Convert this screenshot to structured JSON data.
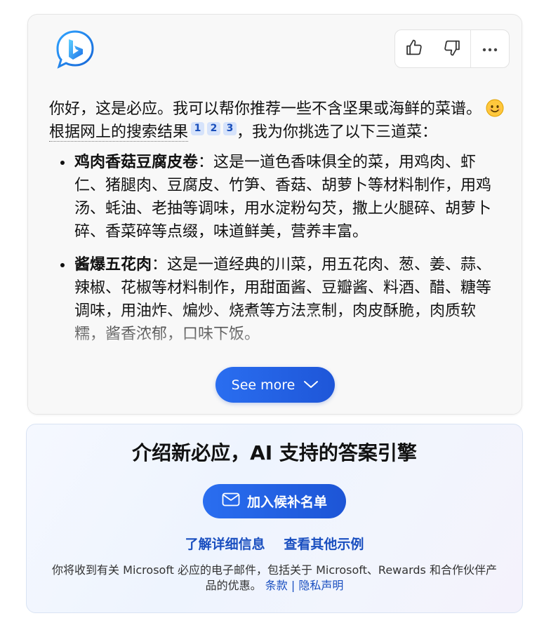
{
  "answer": {
    "greeting": "你好，这是必应。我可以帮你推荐一些不含坚果或海鲜的菜谱。",
    "sources_phrase": "根据网上的搜索结果",
    "citations": [
      "1",
      "2",
      "3"
    ],
    "sources_suffix": "，我为你挑选了以下三道菜：",
    "recipes": [
      {
        "name": "鸡肉香菇豆腐皮卷",
        "description": "：这是一道色香味俱全的菜，用鸡肉、虾仁、猪腿肉、豆腐皮、竹笋、香菇、胡萝卜等材料制作，用鸡汤、蚝油、老抽等调味，用水淀粉勾芡，撒上火腿碎、胡萝卜碎、香菜碎等点缀，味道鲜美，营养丰富。"
      },
      {
        "name": "酱爆五花肉",
        "description": "：这是一道经典的川菜，用五花肉、葱、姜、蒜、辣椒、花椒等材料制作，用甜面酱、豆瓣酱、料酒、醋、糖等调味，用油炸、煸炒、烧煮等方法烹制，肉皮酥脆，肉质软糯，酱香浓郁，口味下饭。"
      }
    ],
    "see_more_label": "See more"
  },
  "promo": {
    "title": "介绍新必应，AI 支持的答案引擎",
    "waitlist_label": "加入候补名单",
    "link_learn_more": "了解详细信息",
    "link_examples": "查看其他示例",
    "disclaimer": "你将收到有关 Microsoft 必应的电子邮件，包括关于 Microsoft、Rewards 和合作伙伴产品的优惠。",
    "terms_label": "条款",
    "separator": " | ",
    "privacy_label": "隐私声明"
  },
  "icons": {
    "logo": "bing-logo-icon",
    "thumbs_up": "thumbs-up-icon",
    "thumbs_down": "thumbs-down-icon",
    "more": "more-icon",
    "chevron": "chevron-down-icon",
    "mail": "mail-icon",
    "emoji": "smile-emoji-icon"
  },
  "colors": {
    "accent_blue": "#1e56d8",
    "link_blue": "#1a4fc0",
    "citation_bg": "#d6e3fb"
  }
}
